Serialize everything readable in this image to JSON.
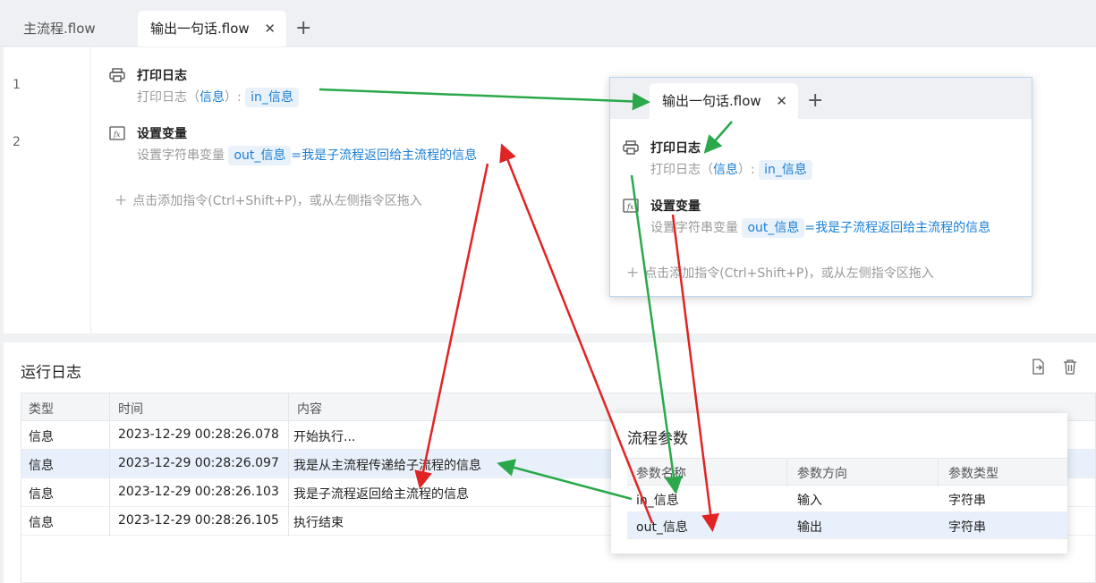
{
  "tabs": [
    {
      "label": "主流程.flow"
    },
    {
      "label": "输出一句话.flow",
      "close": "✕"
    }
  ],
  "tab_add": "+",
  "editor": {
    "lines": [
      "1",
      "2"
    ],
    "commands": [
      {
        "title": "打印日志",
        "desc_prefix": "打印日志（",
        "desc_link": "信息",
        "desc_suffix": "）:",
        "var": "in_信息"
      },
      {
        "title": "设置变量",
        "desc_prefix": "设置字符串变量",
        "var": "out_信息",
        "assign": "=我是子流程返回给主流程的信息"
      }
    ],
    "hint": "点击添加指令(Ctrl+Shift+P)，或从左侧指令区拖入"
  },
  "popup": {
    "tab_label": "输出一句话.flow",
    "close": "✕",
    "add": "+",
    "commands": [
      {
        "title": "打印日志",
        "desc_prefix": "打印日志（",
        "desc_link": "信息",
        "desc_suffix": "）:",
        "var": "in_信息"
      },
      {
        "title": "设置变量",
        "desc_prefix": "设置字符串变量",
        "var": "out_信息",
        "assign": "=我是子流程返回给主流程的信息"
      }
    ],
    "hint": "点击添加指令(Ctrl+Shift+P)，或从左侧指令区拖入"
  },
  "log": {
    "title": "运行日志",
    "columns": [
      "类型",
      "时间",
      "内容"
    ],
    "rows": [
      {
        "type": "信息",
        "time": "2023-12-29 00:28:26.078",
        "content": "开始执行..."
      },
      {
        "type": "信息",
        "time": "2023-12-29 00:28:26.097",
        "content": "我是从主流程传递给子流程的信息"
      },
      {
        "type": "信息",
        "time": "2023-12-29 00:28:26.103",
        "content": "我是子流程返回给主流程的信息"
      },
      {
        "type": "信息",
        "time": "2023-12-29 00:28:26.105",
        "content": "执行结束"
      }
    ]
  },
  "params": {
    "title": "流程参数",
    "columns": [
      "参数名称",
      "参数方向",
      "参数类型"
    ],
    "rows": [
      {
        "name": "in_信息",
        "direction": "输入",
        "type": "字符串"
      },
      {
        "name": "out_信息",
        "direction": "输出",
        "type": "字符串"
      }
    ]
  },
  "colors": {
    "accent": "#1a7fd4",
    "arrow_green": "#2aa84a",
    "arrow_red": "#e02424"
  }
}
